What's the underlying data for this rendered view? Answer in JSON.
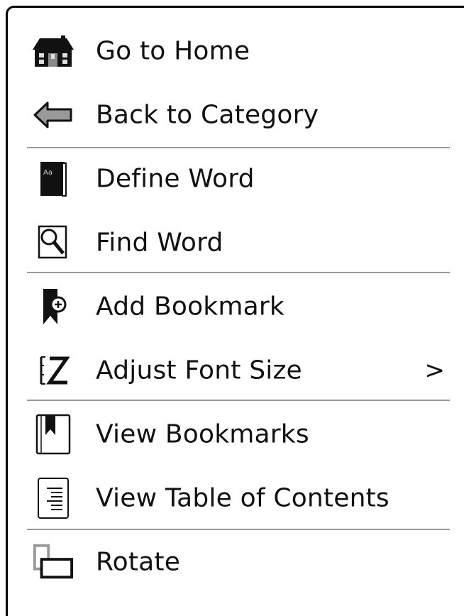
{
  "menu": {
    "items": [
      {
        "label": "Go to Home",
        "icon": "home-icon"
      },
      {
        "label": "Back to Category",
        "icon": "back-arrow-icon"
      },
      {
        "label": "Define Word",
        "icon": "dictionary-icon"
      },
      {
        "label": "Find Word",
        "icon": "find-icon"
      },
      {
        "label": "Add Bookmark",
        "icon": "add-bookmark-icon"
      },
      {
        "label": "Adjust Font Size",
        "icon": "font-size-icon",
        "submenu": ">"
      },
      {
        "label": "View Bookmarks",
        "icon": "bookmarks-icon"
      },
      {
        "label": "View Table of Contents",
        "icon": "table-of-contents-icon"
      },
      {
        "label": "Rotate",
        "icon": "rotate-icon"
      }
    ]
  }
}
